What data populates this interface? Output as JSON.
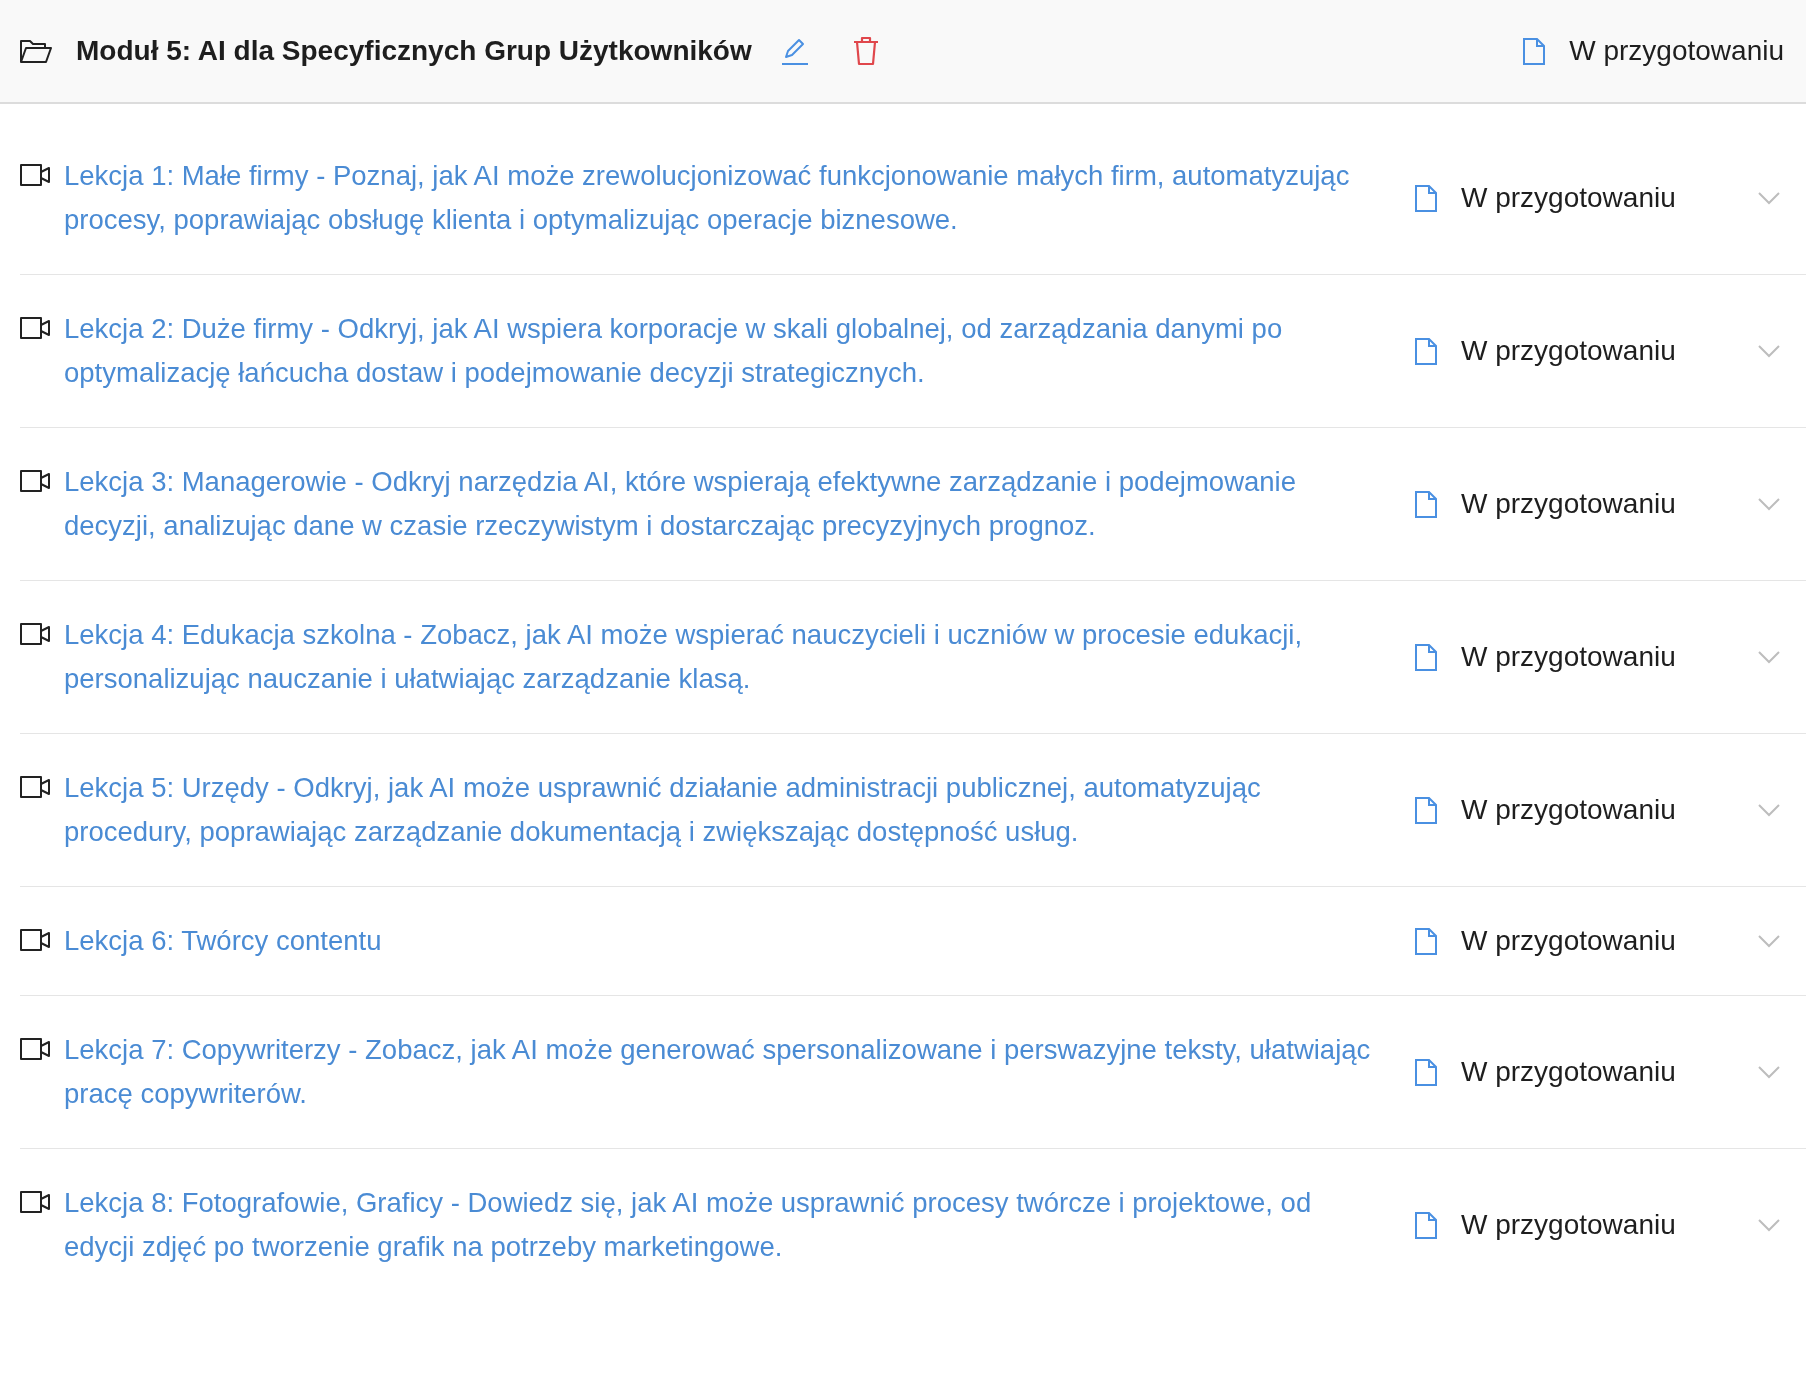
{
  "module": {
    "title": "Moduł 5: AI dla Specyficznych Grup Użytkowników",
    "status": "W przygotowaniu"
  },
  "lessons": [
    {
      "title": "Lekcja 1: Małe firmy - Poznaj, jak AI może zrewolucjonizować funkcjonowanie małych firm, automatyzując procesy, poprawiając obsługę klienta i optymalizując operacje biznesowe.",
      "status": "W przygotowaniu"
    },
    {
      "title": "Lekcja 2: Duże firmy - Odkryj, jak AI wspiera korporacje w skali globalnej, od zarządzania danymi po optymalizację łańcucha dostaw i podejmowanie decyzji strategicznych.",
      "status": "W przygotowaniu"
    },
    {
      "title": "Lekcja 3: Managerowie - Odkryj narzędzia AI, które wspierają efektywne zarządzanie i podejmowanie decyzji, analizując dane w czasie rzeczywistym i dostarczając precyzyjnych prognoz.",
      "status": "W przygotowaniu"
    },
    {
      "title": "Lekcja 4: Edukacja szkolna - Zobacz, jak AI może wspierać nauczycieli i uczniów w procesie edukacji, personalizując nauczanie i ułatwiając zarządzanie klasą.",
      "status": "W przygotowaniu"
    },
    {
      "title": "Lekcja 5: Urzędy - Odkryj, jak AI może usprawnić działanie administracji publicznej, automatyzując procedury, poprawiając zarządzanie dokumentacją i zwiększając dostępność usług.",
      "status": "W przygotowaniu"
    },
    {
      "title": "Lekcja 6: Twórcy contentu",
      "status": "W przygotowaniu"
    },
    {
      "title": "Lekcja 7: Copywriterzy - Zobacz, jak AI może generować spersonalizowane i perswazyjne teksty, ułatwiając pracę copywriterów.",
      "status": "W przygotowaniu"
    },
    {
      "title": "Lekcja 8: Fotografowie, Graficy - Dowiedz się, jak AI może usprawnić procesy twórcze i projektowe, od edycji zdjęć po tworzenie grafik na potrzeby marketingowe.",
      "status": "W przygotowaniu"
    }
  ]
}
